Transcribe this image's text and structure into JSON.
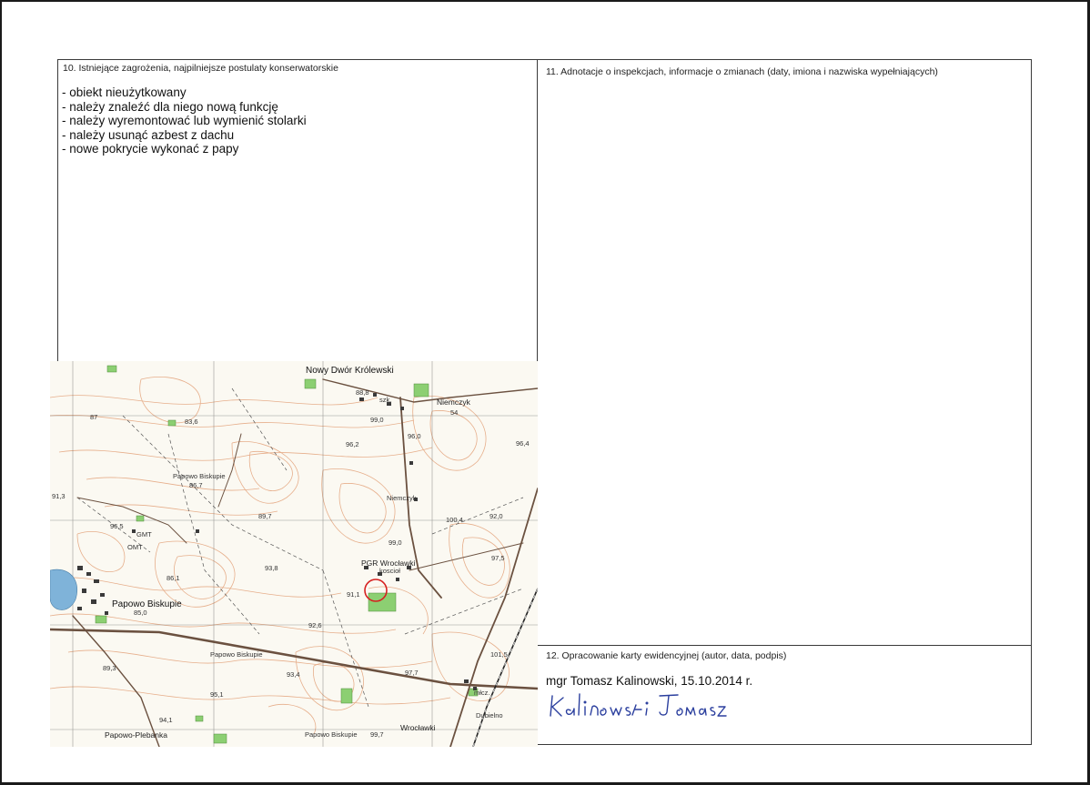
{
  "section10": {
    "heading": "10. Istniejące zagrożenia, najpilniejsze postulaty konserwatorskie",
    "items": [
      "obiekt nieużytkowany",
      "należy znaleźć dla niego nową funkcję",
      "należy wyremontować lub wymienić stolarki",
      "należy usunąć azbest z dachu",
      "nowe pokrycie wykonać z papy"
    ]
  },
  "section11": {
    "heading": "11. Adnotacje o inspekcjach, informacje o zmianach (daty, imiona i nazwiska wypełniających)"
  },
  "section12": {
    "heading": "12. Opracowanie karty ewidencyjnej (autor, data, podpis)",
    "author": "mgr Tomasz Kalinowski, 15.10.2014 r.",
    "signature_text": "Kalinowski Tomasz"
  },
  "map": {
    "labels": [
      "Nowy Dwór Królewski",
      "Niemczyk",
      "Papowo Biskupie",
      "Papowo Biskupie",
      "PGR Wrocławki",
      "Papowo Biskupie",
      "Papowo-Plebanka",
      "Papowo Biskupie",
      "Wrocławki",
      "Niemczyk",
      "Dubielno",
      "GMT",
      "OMT",
      "szk.",
      "koscioł",
      "młcz.",
      "88,8",
      "99,0",
      "96,0",
      "96,2",
      "83,6",
      "86,7",
      "89,7",
      "96,5",
      "92,0",
      "100,4",
      "97,5",
      "99,0",
      "93,8",
      "91,1",
      "92,6",
      "93,4",
      "95,1",
      "97,7",
      "101,5",
      "99,7",
      "94,1",
      "86,1",
      "85,0",
      "91,3",
      "89,3",
      "87",
      "96,4",
      "54"
    ]
  },
  "colors": {
    "border": "#3a3a3a",
    "contour": "#e3a27a",
    "water": "#7fb3d9",
    "forest": "#8ccf72",
    "road": "#6b5140",
    "signature_ink": "#2b3f9e",
    "highlight_circle": "#d62020"
  }
}
